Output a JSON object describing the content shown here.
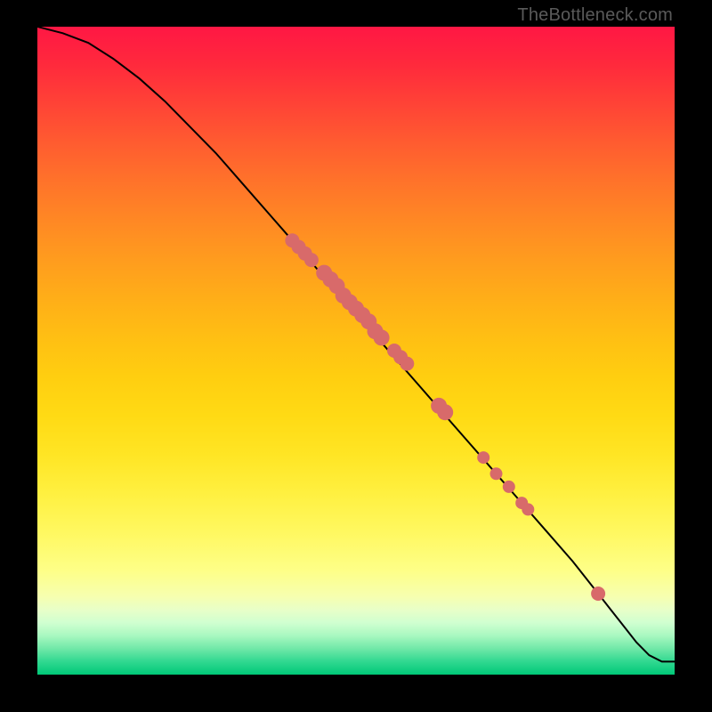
{
  "watermark": "TheBottleneck.com",
  "colors": {
    "dot": "#d86a6a",
    "curve": "#000000",
    "frame": "#000000"
  },
  "chart_data": {
    "type": "line",
    "title": "",
    "xlabel": "",
    "ylabel": "",
    "xlim": [
      0,
      100
    ],
    "ylim": [
      0,
      100
    ],
    "grid": false,
    "curve": {
      "x": [
        0,
        4,
        8,
        12,
        16,
        20,
        24,
        28,
        32,
        36,
        40,
        44,
        48,
        52,
        56,
        60,
        64,
        68,
        72,
        76,
        80,
        84,
        88,
        90,
        92,
        94,
        96,
        98,
        100
      ],
      "y": [
        100,
        99,
        97.5,
        95,
        92,
        88.5,
        84.5,
        80.5,
        76,
        71.5,
        67,
        62.5,
        58,
        53.5,
        49,
        44.5,
        40,
        35.5,
        31,
        26.5,
        22,
        17.5,
        12.5,
        10,
        7.5,
        5,
        3,
        2,
        2
      ]
    },
    "highlight_points": {
      "x": [
        40,
        41,
        42,
        43,
        45,
        46,
        47,
        48,
        49,
        50,
        51,
        52,
        53,
        54,
        56,
        57,
        58,
        63,
        64,
        70,
        72,
        74,
        76,
        77,
        88
      ],
      "y": [
        67,
        66,
        65,
        64,
        62,
        61,
        60,
        58.5,
        57.5,
        56.5,
        55.5,
        54.5,
        53,
        52,
        50,
        49,
        48,
        41.5,
        40.5,
        33.5,
        31,
        29,
        26.5,
        25.5,
        12.5
      ],
      "r": [
        8,
        8,
        8,
        8,
        9,
        9,
        9,
        9,
        9,
        9,
        9,
        9,
        9,
        9,
        8,
        8,
        8,
        9,
        9,
        7,
        7,
        7,
        7,
        7,
        8
      ]
    }
  }
}
